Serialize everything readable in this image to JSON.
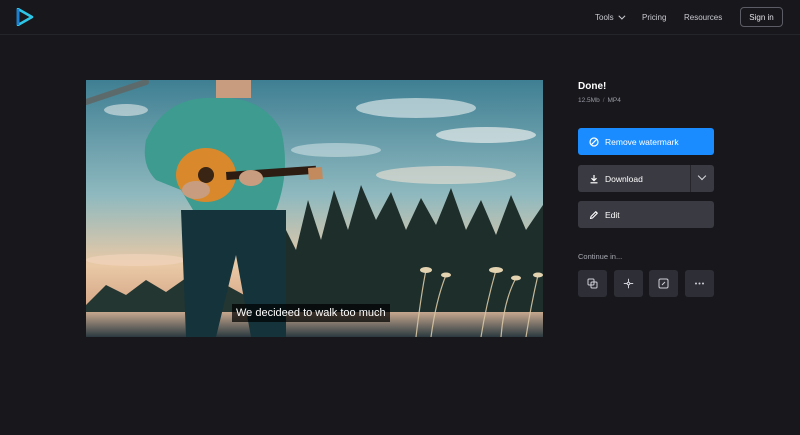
{
  "header": {
    "nav": {
      "tools": "Tools",
      "pricing": "Pricing",
      "resources": "Resources"
    },
    "signin": "Sign in"
  },
  "video": {
    "subtitle": "We decideed to walk too much"
  },
  "result": {
    "title": "Done!",
    "size": "12.5Mb",
    "format": "MP4",
    "sep": "/"
  },
  "actions": {
    "remove_watermark": "Remove watermark",
    "download": "Download",
    "edit": "Edit"
  },
  "continue": {
    "label": "Continue in...",
    "tools": [
      "copy-icon",
      "sparkle-icon",
      "frame-icon",
      "more-icon"
    ]
  },
  "colors": {
    "accent": "#1a8cff",
    "logo": "#2ec6e6",
    "background": "#17171c"
  }
}
